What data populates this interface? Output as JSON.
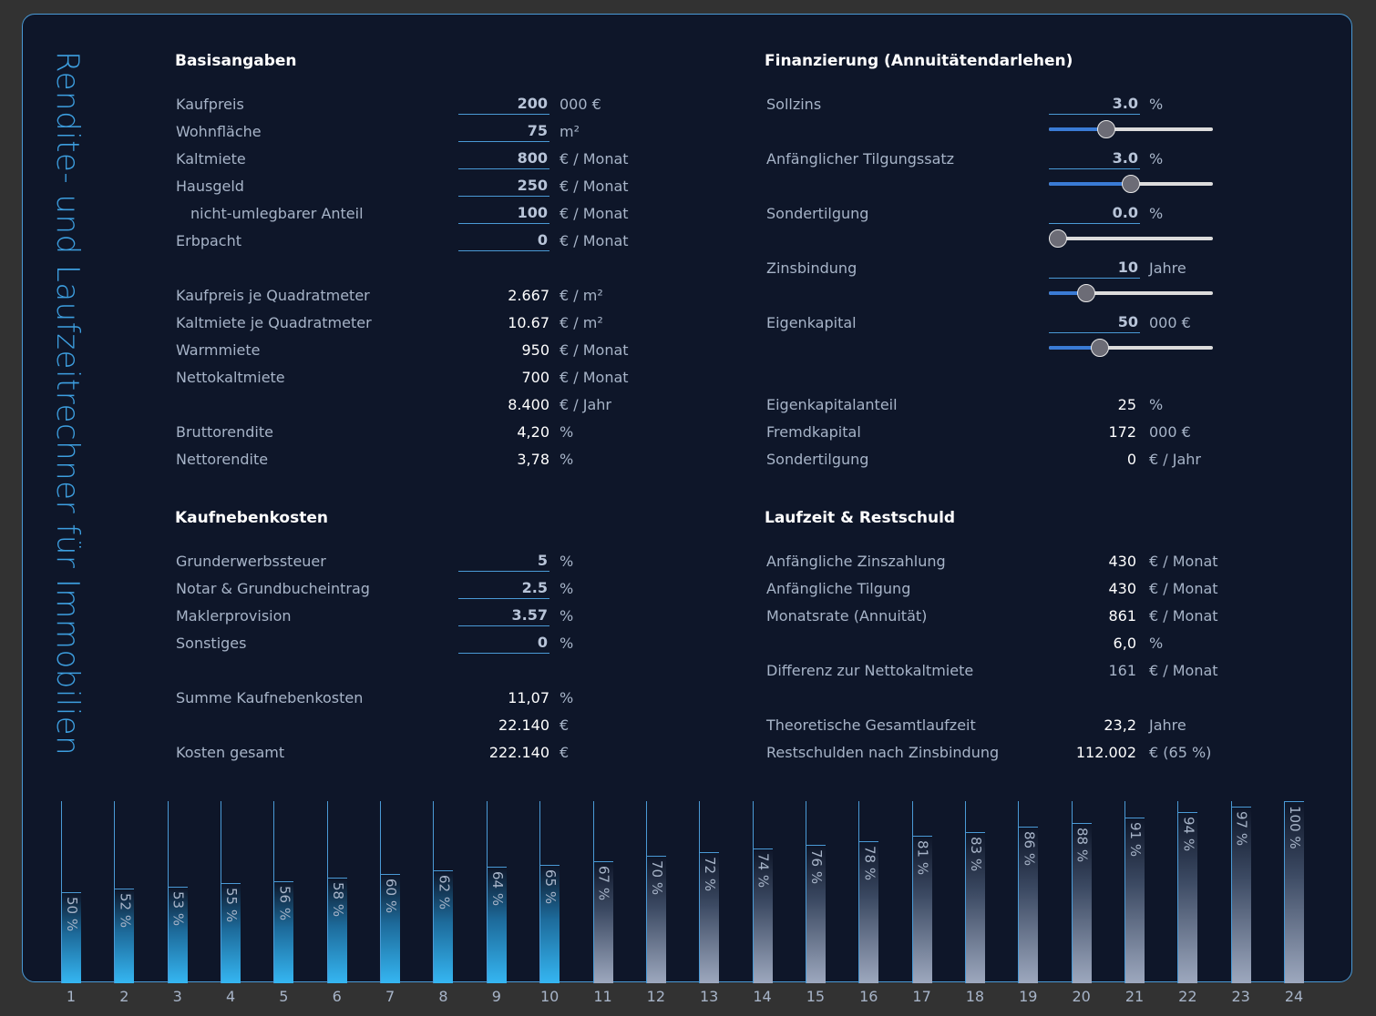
{
  "title": "Rendite- und Laufzeitrechner für Immobilien",
  "basis": {
    "heading": "Basisangaben",
    "inputs": [
      {
        "label": "Kaufpreis",
        "value": "200",
        "unit": "000 €"
      },
      {
        "label": "Wohnfläche",
        "value": "75",
        "unit": "m²"
      },
      {
        "label": "Kaltmiete",
        "value": "800",
        "unit": "€ / Monat"
      },
      {
        "label": "Hausgeld",
        "value": "250",
        "unit": "€ / Monat"
      },
      {
        "label": "nicht-umlegbarer Anteil",
        "value": "100",
        "unit": "€ / Monat"
      },
      {
        "label": "Erbpacht",
        "value": "0",
        "unit": "€ / Monat"
      }
    ],
    "outputs": [
      {
        "label": "Kaufpreis je Quadratmeter",
        "value": "2.667",
        "unit": "€ / m²"
      },
      {
        "label": "Kaltmiete je Quadratmeter",
        "value": "10.67",
        "unit": "€ / m²"
      },
      {
        "label": "Warmmiete",
        "value": "950",
        "unit": "€ / Monat"
      },
      {
        "label": "Nettokaltmiete",
        "value": "700",
        "unit": "€ / Monat"
      },
      {
        "label": "",
        "value": "8.400",
        "unit": "€ / Jahr"
      },
      {
        "label": "Bruttorendite",
        "value": "4,20",
        "unit": "%"
      },
      {
        "label": "Nettorendite",
        "value": "3,78",
        "unit": "%"
      }
    ]
  },
  "nebenkosten": {
    "heading": "Kaufnebenkosten",
    "inputs": [
      {
        "label": "Grunderwerbssteuer",
        "value": "5",
        "unit": "%"
      },
      {
        "label": "Notar & Grundbucheintrag",
        "value": "2.5",
        "unit": "%"
      },
      {
        "label": "Maklerprovision",
        "value": "3.57",
        "unit": "%"
      },
      {
        "label": "Sonstiges",
        "value": "0",
        "unit": "%"
      }
    ],
    "outputs": [
      {
        "label": "Summe Kaufnebenkosten",
        "value": "11,07",
        "unit": "%"
      },
      {
        "label": "",
        "value": "22.140",
        "unit": "€"
      },
      {
        "label": "Kosten gesamt",
        "value": "222.140",
        "unit": "€"
      }
    ]
  },
  "finanzierung": {
    "heading": "Finanzierung (Annuitätendarlehen)",
    "inputs": [
      {
        "label": "Sollzins",
        "value": "3.0",
        "unit": "%",
        "slider": 0.35
      },
      {
        "label": "Anfänglicher Tilgungssatz",
        "value": "3.0",
        "unit": "%",
        "slider": 0.5
      },
      {
        "label": "Sondertilgung",
        "value": "0.0",
        "unit": "%",
        "slider": 0.0
      },
      {
        "label": "Zinsbindung",
        "value": "10",
        "unit": "Jahre",
        "slider": 0.23
      },
      {
        "label": "Eigenkapital",
        "value": "50",
        "unit": "000 €",
        "slider": 0.31
      }
    ],
    "outputs": [
      {
        "label": "Eigenkapitalanteil",
        "value": "25",
        "unit": "%"
      },
      {
        "label": "Fremdkapital",
        "value": "172",
        "unit": "000 €"
      },
      {
        "label": "Sondertilgung",
        "value": "0",
        "unit": "€ / Jahr"
      }
    ]
  },
  "laufzeit": {
    "heading": "Laufzeit & Restschuld",
    "outputs": [
      {
        "label": "Anfängliche Zinszahlung",
        "value": "430",
        "unit": "€ / Monat",
        "muted": false
      },
      {
        "label": "Anfängliche Tilgung",
        "value": "430",
        "unit": "€ / Monat",
        "muted": false
      },
      {
        "label": "Monatsrate (Annuität)",
        "value": "861",
        "unit": "€ / Monat",
        "muted": false
      },
      {
        "label": "",
        "value": "6,0",
        "unit": "%",
        "muted": false
      },
      {
        "label": "Differenz zur Nettokaltmiete",
        "value": "161",
        "unit": "€ / Monat",
        "muted": true
      },
      {
        "label": "Theoretische Gesamtlaufzeit",
        "value": "23,2",
        "unit": "Jahre",
        "muted": false
      },
      {
        "label": "Restschulden nach Zinsbindung",
        "value": "112.002",
        "unit": "€ (65 %)",
        "muted": false
      }
    ]
  },
  "chart_data": {
    "type": "bar",
    "categories": [
      "1",
      "2",
      "3",
      "4",
      "5",
      "6",
      "7",
      "8",
      "9",
      "10",
      "11",
      "12",
      "13",
      "14",
      "15",
      "16",
      "17",
      "18",
      "19",
      "20",
      "21",
      "22",
      "23",
      "24"
    ],
    "values": [
      50,
      52,
      53,
      55,
      56,
      58,
      60,
      62,
      64,
      65,
      67,
      70,
      72,
      74,
      76,
      78,
      81,
      83,
      86,
      88,
      91,
      94,
      97,
      100
    ],
    "value_labels": [
      "50 %",
      "52 %",
      "53 %",
      "55 %",
      "56 %",
      "58 %",
      "60 %",
      "62 %",
      "64 %",
      "65 %",
      "67 %",
      "70 %",
      "72 %",
      "74 %",
      "76 %",
      "78 %",
      "81 %",
      "83 %",
      "86 %",
      "88 %",
      "91 %",
      "94 %",
      "97 %",
      "100 %"
    ],
    "highlighted_through": 10,
    "colors": {
      "paid": "#35b6f2",
      "rest": "#9da8be",
      "line": "#4a9ad6"
    },
    "ylim": [
      0,
      100
    ]
  }
}
